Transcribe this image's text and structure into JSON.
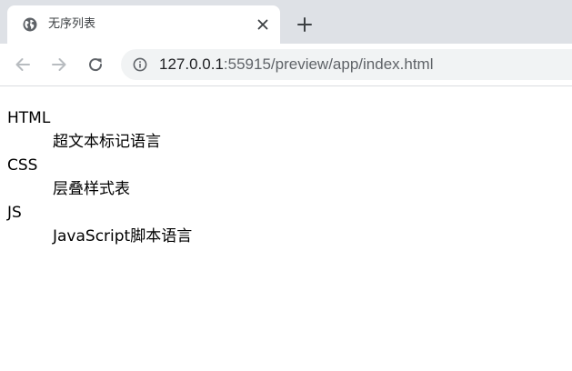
{
  "browser": {
    "tab": {
      "title": "无序列表",
      "favicon": "globe-icon"
    },
    "address": {
      "host": "127.0.0.1",
      "rest": ":55915/preview/app/index.html"
    },
    "colors": {
      "tabstrip": "#dee1e6",
      "omnibox": "#f1f3f4",
      "icon": "#5f6368"
    }
  },
  "page": {
    "definitions": [
      {
        "term": "HTML",
        "description": "超文本标记语言"
      },
      {
        "term": "CSS",
        "description": "层叠样式表"
      },
      {
        "term": "JS",
        "description": "JavaScript脚本语言"
      }
    ]
  }
}
